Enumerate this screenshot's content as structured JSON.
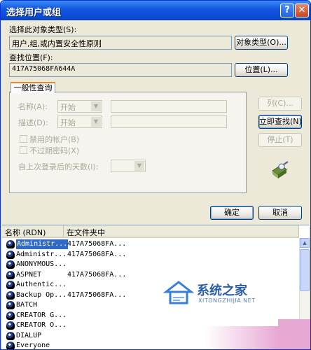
{
  "window": {
    "title": "选择用户或组",
    "help_label": "?",
    "close_label": "✕"
  },
  "object_type": {
    "label": "选择此对象类型(S):",
    "value": "用户,组,或内置安全性原则",
    "button": "对象类型(O)..."
  },
  "location": {
    "label": "查找位置(F):",
    "value": "417A75068FA644A",
    "button": "位置(L)..."
  },
  "general_query": {
    "tab": "一般性查询",
    "name_label": "名称(A):",
    "name_op": "开始",
    "desc_label": "描述(D):",
    "desc_op": "开始",
    "disabled_accounts": "禁用的帐户(B)",
    "non_expiring_pw": "不过期密码(X)",
    "days_since_logon": "自上次登录后的天数(I):"
  },
  "buttons": {
    "columns": "列(C)...",
    "find_now": "立即查找(N)",
    "stop": "停止(T)",
    "ok": "确定",
    "cancel": "取消"
  },
  "results": {
    "headers": [
      "名称 (RDN)",
      "在文件夹中"
    ],
    "rows": [
      {
        "name": "Administr...",
        "folder": "417A75068FA...",
        "selected": true
      },
      {
        "name": "Administr...",
        "folder": "417A75068FA...",
        "selected": false
      },
      {
        "name": "ANONYMOUS...",
        "folder": "",
        "selected": false
      },
      {
        "name": "ASPNET",
        "folder": "417A75068FA...",
        "selected": false
      },
      {
        "name": "Authentic...",
        "folder": "",
        "selected": false
      },
      {
        "name": "Backup Op...",
        "folder": "417A75068FA...",
        "selected": false
      },
      {
        "name": "BATCH",
        "folder": "",
        "selected": false
      },
      {
        "name": "CREATOR G...",
        "folder": "",
        "selected": false
      },
      {
        "name": "CREATOR O...",
        "folder": "",
        "selected": false
      },
      {
        "name": "DIALUP",
        "folder": "",
        "selected": false
      },
      {
        "name": "Everyone",
        "folder": "",
        "selected": false
      }
    ]
  },
  "watermark": {
    "brand": "系统之家",
    "url": "XITONGZHIJIA.NET"
  }
}
